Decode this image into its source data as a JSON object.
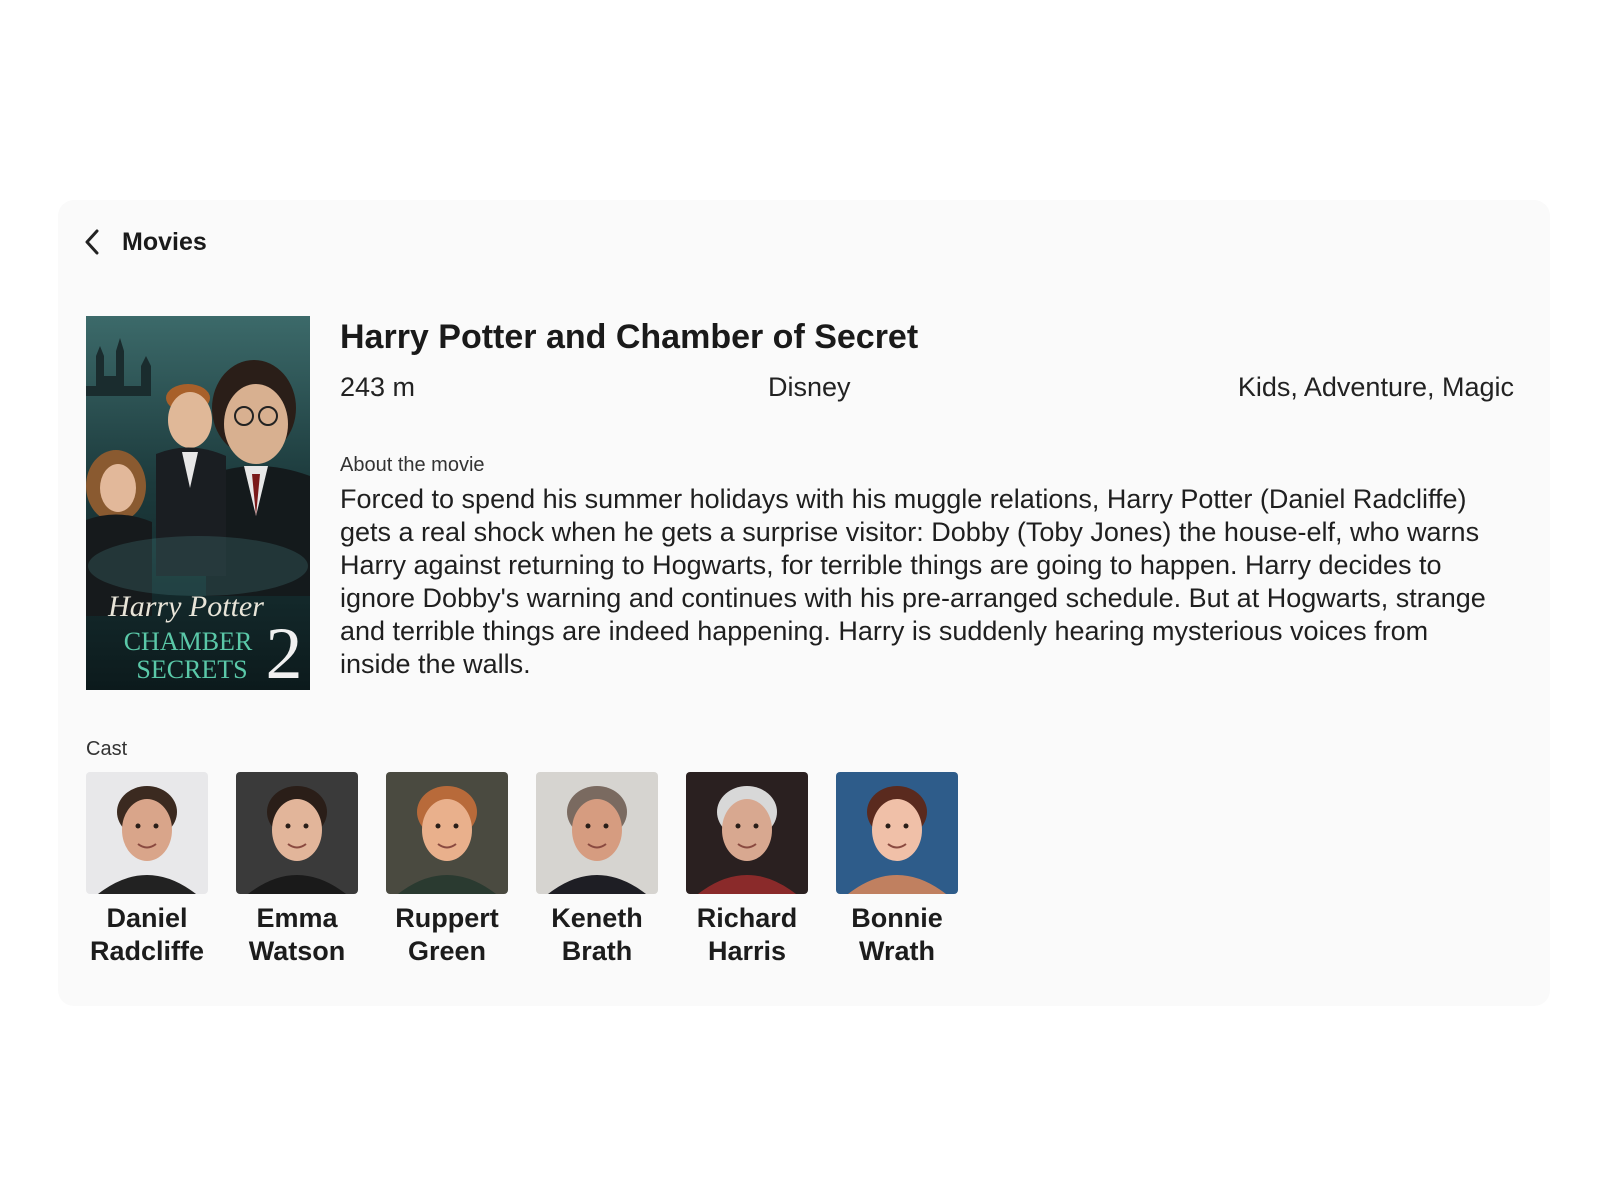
{
  "header": {
    "back_icon": "chevron-left-icon",
    "title": "Movies"
  },
  "movie": {
    "title": "Harry Potter and Chamber of Secret",
    "duration": "243 m",
    "studio": "Disney",
    "genres": "Kids, Adventure, Magic",
    "about_label": "About the movie",
    "description": "Forced to spend his summer holidays with his muggle relations, Harry Potter (Daniel Radcliffe) gets a real shock when he gets a surprise visitor: Dobby (Toby Jones) the house-elf, who warns Harry against returning to Hogwarts, for terrible things are going to happen. Harry decides to ignore Dobby's warning and continues with his pre-arranged schedule. But at Hogwarts, strange and terrible things are indeed happening. Harry is suddenly hearing mysterious voices from inside the walls.",
    "poster": {
      "line1": "Harry Potter",
      "line2": "CHAMBER",
      "line3": "SECRETS",
      "number": "2"
    }
  },
  "cast": {
    "label": "Cast",
    "members": [
      {
        "first": "Daniel",
        "last": "Radcliffe",
        "bg": "#e8e8ea",
        "skin": "#d9a58a",
        "hair": "#3b2a20",
        "shirt": "#222222"
      },
      {
        "first": "Emma",
        "last": "Watson",
        "bg": "#3a3a3a",
        "skin": "#e2b59a",
        "hair": "#2a1e18",
        "shirt": "#1a1a1a"
      },
      {
        "first": "Ruppert",
        "last": "Green",
        "bg": "#4a4a40",
        "skin": "#e9b08c",
        "hair": "#b86a3a",
        "shirt": "#2a3a30"
      },
      {
        "first": "Keneth",
        "last": "Brath",
        "bg": "#d6d4d0",
        "skin": "#d69c80",
        "hair": "#7a6a60",
        "shirt": "#1e1e24"
      },
      {
        "first": "Richard",
        "last": "Harris",
        "bg": "#2a2020",
        "skin": "#d8a890",
        "hair": "#d8d8d8",
        "shirt": "#8a2a2a"
      },
      {
        "first": "Bonnie",
        "last": "Wrath",
        "bg": "#2e5c8a",
        "skin": "#f0c0a8",
        "hair": "#5a2a1e",
        "shirt": "#c08060"
      }
    ]
  }
}
